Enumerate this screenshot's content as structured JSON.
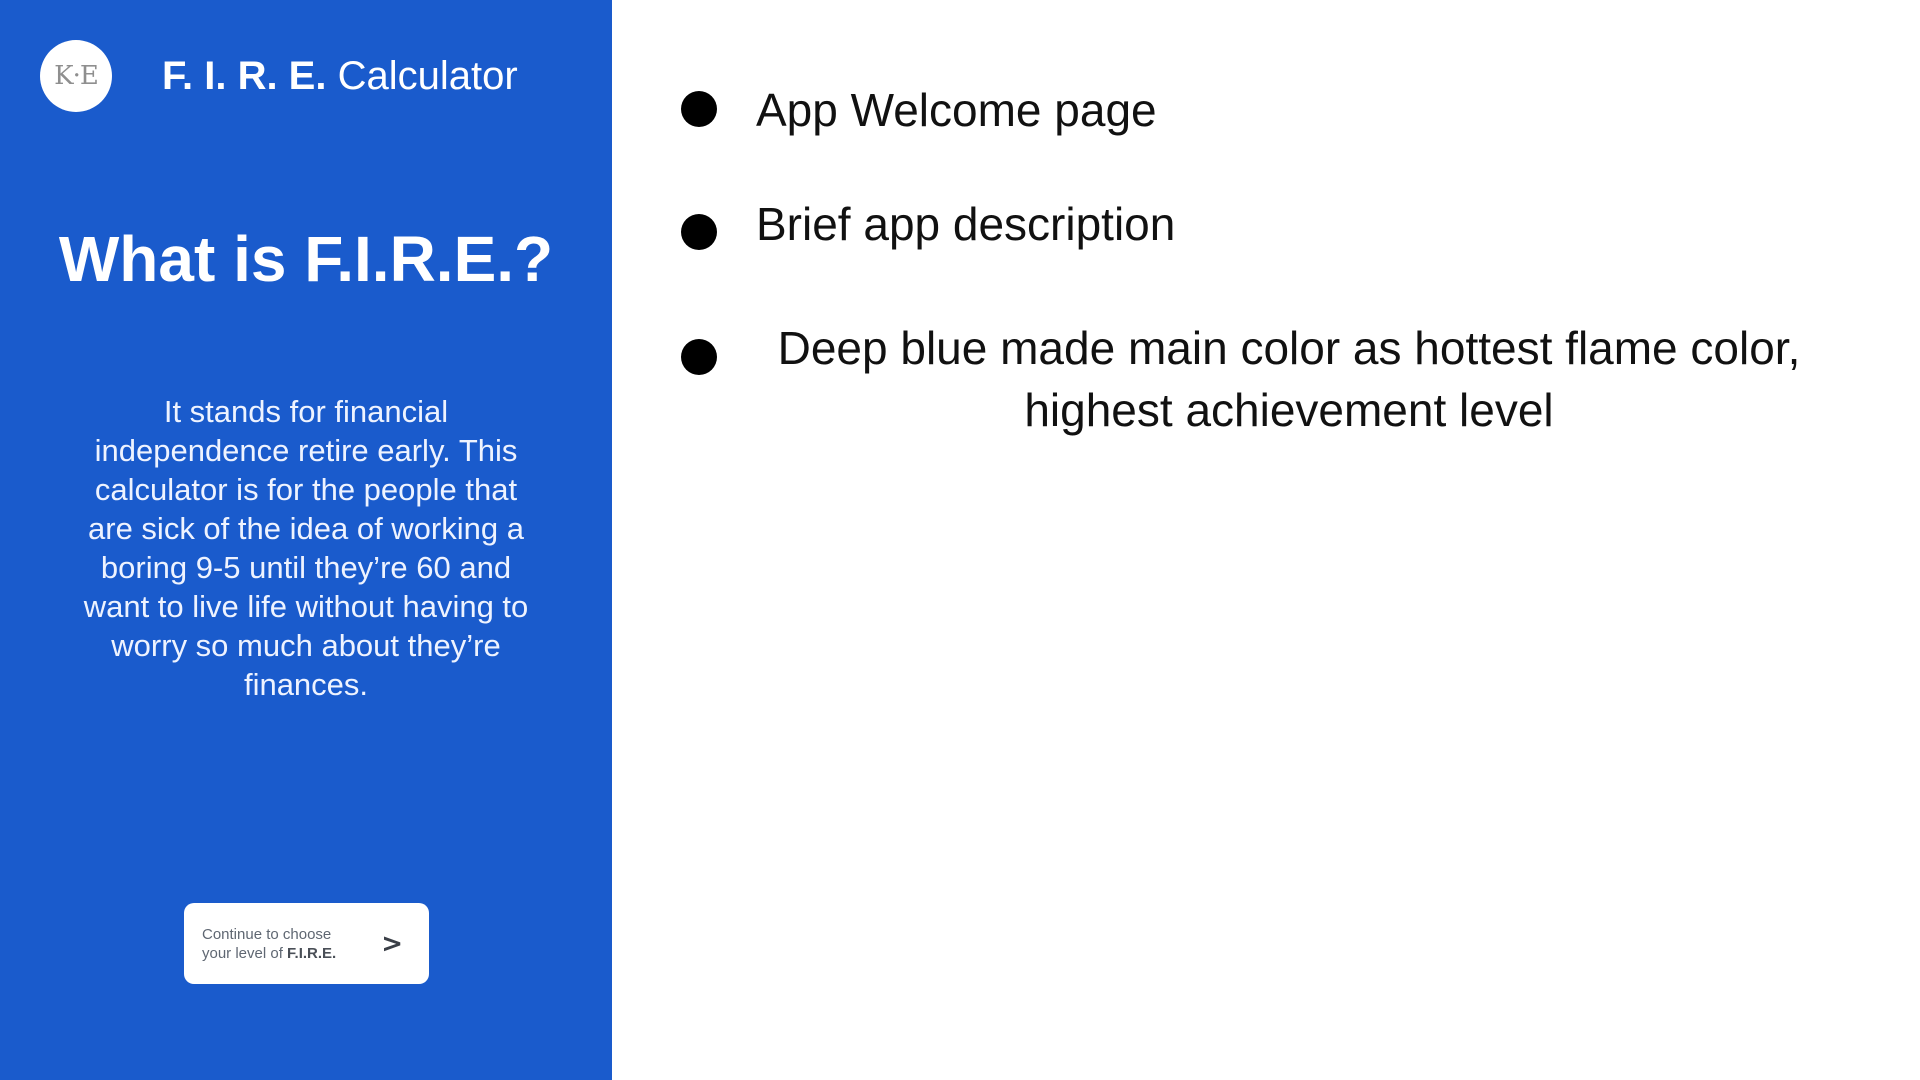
{
  "app": {
    "logo_text": "K·E",
    "title_abbr": "F. I. R. E.",
    "title_rest": " Calculator",
    "headline": "What is F.I.R.E.?",
    "description": "It stands for financial independence retire early. This calculator is for the people that are sick of the idea of working a boring 9-5 until they’re 60 and want to live life without having to worry so much about they’re finances.",
    "continue_line1": "Continue to choose",
    "continue_line2_prefix": "your level of ",
    "continue_line2_strong": "F.I.R.E.",
    "continue_chevron": ">"
  },
  "notes": [
    "App Welcome page",
    "Brief app description",
    "Deep blue made main color as hottest flame color, highest achievement level"
  ],
  "colors": {
    "panel_blue": "#1a5bcc",
    "text_white": "#ffffff",
    "bullet_black": "#000000"
  },
  "icons": {
    "logo": "ke-monogram-logo",
    "continue": "chevron-right-icon",
    "bullet": "bullet-dot-icon"
  }
}
